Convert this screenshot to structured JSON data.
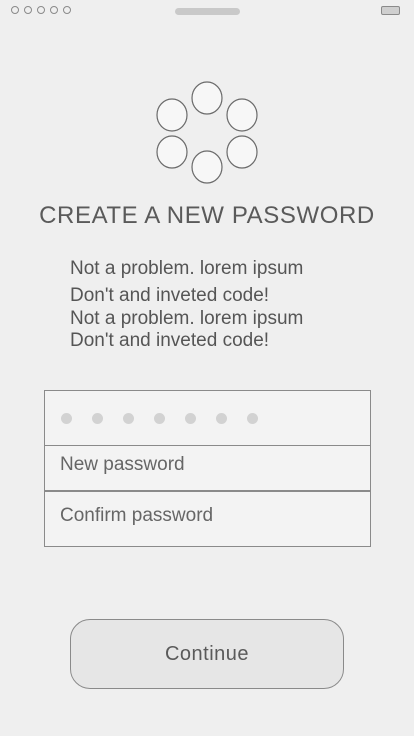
{
  "status_bar": {
    "battery_icon": "battery-icon",
    "signal_icon": "signal-dots-icon"
  },
  "logo": {
    "icon": "circle-flower-logo-icon"
  },
  "title": "CREATE A NEW PASSWORD",
  "description": [
    "Not a problem. lorem ipsum",
    "Don't and inveted code!",
    "Not a problem. lorem ipsum",
    "Don't and inveted code!"
  ],
  "form": {
    "code_placeholder_icon": "code-dots-icon",
    "new_password_placeholder": "New password",
    "confirm_password_placeholder": "Confirm password"
  },
  "continue_label": "Continue"
}
